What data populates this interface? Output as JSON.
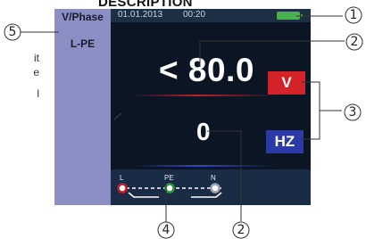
{
  "heading": "DESCRIPTION",
  "side_text": [
    "it",
    "e",
    "l"
  ],
  "screen": {
    "sidebar": {
      "mode": "V/Phase",
      "sub": "L-PE"
    },
    "topbar": {
      "date": "01.01.2013",
      "time": "00:20"
    },
    "main_value": "< 80.0",
    "main_unit": "V",
    "secondary_value": "0",
    "secondary_unit": "HZ",
    "probes": [
      "L",
      "PE",
      "N"
    ],
    "colors": {
      "voltage": "#d42328",
      "frequency": "#2c3aa6",
      "battery": "#48b14a",
      "probe_l": "#c0202e",
      "probe_pe": "#2e9a3c",
      "probe_n": "#9aa2ad"
    }
  },
  "callouts": [
    "1",
    "2",
    "3",
    "4",
    "2",
    "5"
  ]
}
